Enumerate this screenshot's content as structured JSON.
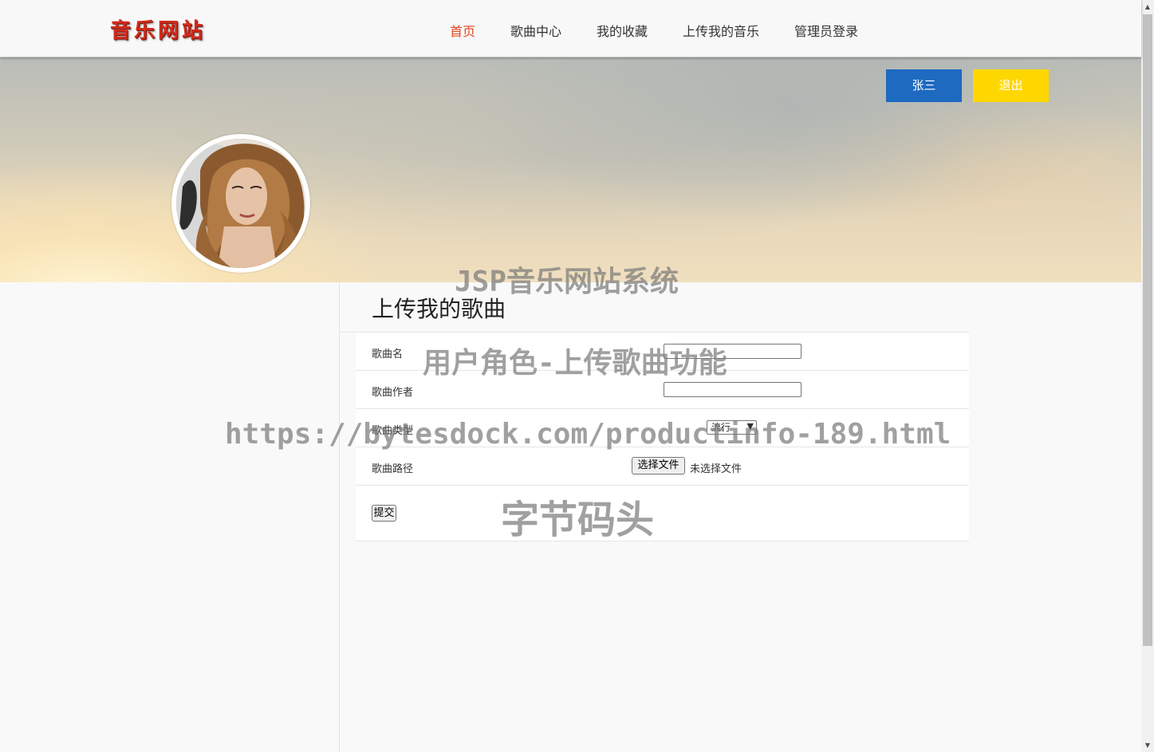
{
  "header": {
    "logo_text": "音乐网站",
    "nav": [
      {
        "label": "首页",
        "active": true
      },
      {
        "label": "歌曲中心",
        "active": false
      },
      {
        "label": "我的收藏",
        "active": false
      },
      {
        "label": "上传我的音乐",
        "active": false
      },
      {
        "label": "管理员登录",
        "active": false
      }
    ]
  },
  "banner": {
    "user_button": "张三",
    "logout_button": "退出"
  },
  "main": {
    "title": "上传我的歌曲",
    "form": {
      "song_name_label": "歌曲名",
      "song_name_value": "",
      "author_label": "歌曲作者",
      "author_value": "",
      "type_label": "歌曲类型",
      "type_selected": "流行",
      "path_label": "歌曲路径",
      "file_button": "选择文件",
      "file_status": "未选择文件",
      "submit_label": "提交"
    }
  },
  "watermarks": {
    "line1": "JSP音乐网站系统",
    "line2": "用户角色-上传歌曲功能",
    "line3": "https://bytesdock.com/productinfo-189.html",
    "line4": "字节码头"
  },
  "colors": {
    "nav_active": "#e3461f",
    "user_button_bg": "#1d6ac0",
    "logout_button_bg": "#ffd700"
  }
}
